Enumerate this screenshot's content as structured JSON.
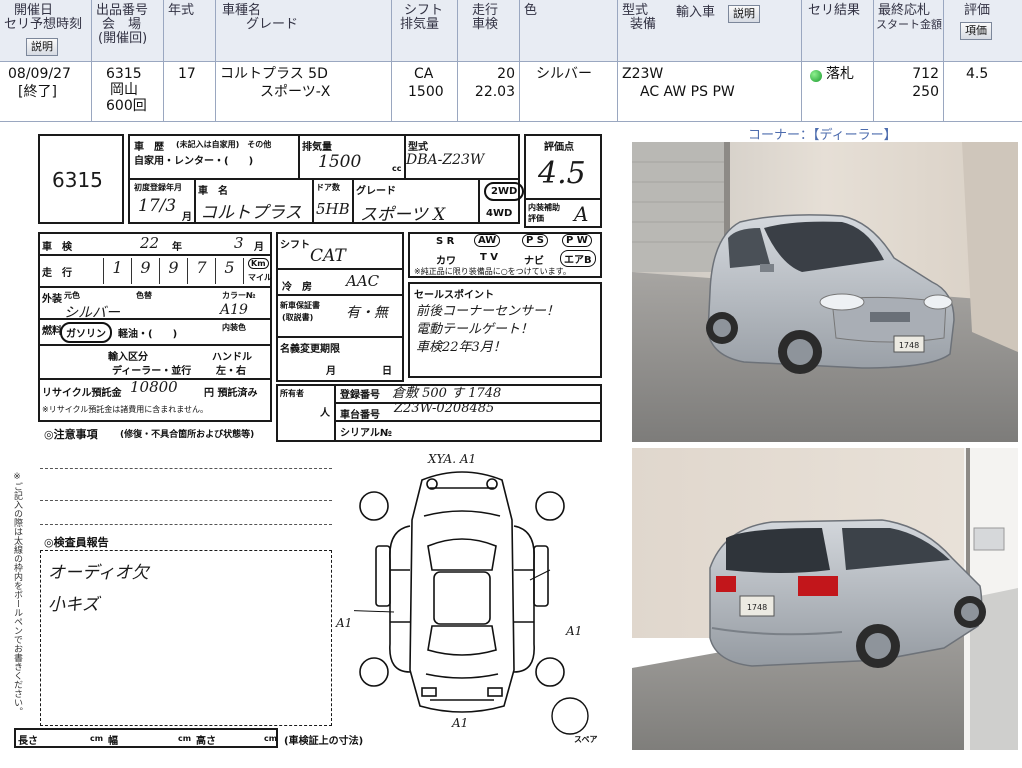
{
  "header": {
    "col_date": [
      "開催日",
      "セリ予想時刻"
    ],
    "col_lot": [
      "出品番号",
      "会　場",
      "(開催回)"
    ],
    "col_year": "年式",
    "col_model": [
      "車種名",
      "グレード"
    ],
    "col_shift": [
      "シフト",
      "排気量"
    ],
    "col_mileage": [
      "走行",
      "車検"
    ],
    "col_color": "色",
    "col_type": [
      "型式",
      "装備"
    ],
    "col_import": "輸入車",
    "col_result": "セリ結果",
    "col_price": [
      "最終応札",
      "スタート金額"
    ],
    "col_score": "評価",
    "explain_button": "説明",
    "explain_button2": "説明",
    "score_button": "項価"
  },
  "lot": {
    "date": "08/09/27",
    "status": "[終了]",
    "lot_number": "6315",
    "venue": "岡山",
    "session": "600回",
    "year": "17",
    "model": "コルトプラス 5D",
    "grade": "スポーツ-X",
    "shift": "CA",
    "displacement": "1500",
    "mileage": "20",
    "inspection": "22.03",
    "color": "シルバー",
    "type_code": "Z23W",
    "equipment": "AC AW PS PW",
    "result": "落札",
    "final_bid": "712",
    "start_price": "250",
    "score": "4.5",
    "result_color": "#22b14c"
  },
  "sheet": {
    "lot_no": "6315",
    "history_label": "車　歴",
    "history_options": "(未記入は自家用)　その他",
    "history_value": "自家用・レンター・(　　)",
    "displacement_label": "排気量",
    "displacement_hand": "1500",
    "displacement_unit": "cc",
    "type_label": "型式",
    "type_hand": "DBA-Z23W",
    "score_label": "評価点",
    "score_hand": "4.5",
    "first_reg_label": "初度登録年月",
    "first_reg_hand": "17/3",
    "first_reg_unit": "月",
    "name_label": "車　名",
    "name_hand": "コルトプラス",
    "doors_label": "ドア数",
    "doors_hand": "5HB",
    "grade_label": "グレード",
    "grade_hand": "スポーツ X",
    "drive_2wd": "2WD",
    "drive_4wd": "4WD",
    "interior_label": "内装補助評価",
    "interior_hand": "A",
    "inspection_label": "車　検",
    "inspection_year": "22",
    "inspection_year_unit": "年",
    "inspection_month": "3",
    "inspection_month_unit": "月",
    "mileage_label": "走　行",
    "mileage_digits": [
      "1",
      "9",
      "9",
      "7",
      "5"
    ],
    "mileage_unit_km": "Km",
    "mileage_unit_mile": "マイル",
    "shift_label": "シフト",
    "shift_hand": "CAT",
    "cooler_label": "冷　房",
    "cooler_hand": "AAC",
    "exterior_color_label": "外装",
    "orig_color_label": "元色",
    "color_change_label": "色替",
    "color_code_label": "カラー№",
    "exterior_color_hand": "シルバー",
    "color_code_hand": "A19",
    "fuel_label": "燃料",
    "fuel_hand": "ガソリン",
    "fuel_other": "軽油・(　　)",
    "interior_color_label": "内装色",
    "warranty_label": "新車保証書",
    "warranty_sub": "(取説書)",
    "warranty_hand": "有・無",
    "import_label": "輸入区分",
    "handle_label": "ハンドル",
    "import_hand": "ディーラー・並行",
    "handle_hand": "左・右",
    "recycle_label": "リサイクル預託金",
    "recycle_hand": "10800",
    "recycle_unit": "円 預託済み",
    "recycle_note": "※リサイクル預託金は諸費用に含まれません。",
    "name_change_label": "名義変更期限",
    "name_change_month": "月",
    "name_change_day": "日",
    "equip_sr": "S R",
    "equip_aw": "AW",
    "equip_ps": "P S",
    "equip_pw": "P W",
    "equip_kawa": "カワ",
    "equip_tv": "T V",
    "equip_navi": "ナビ",
    "equip_airbag": "エアB",
    "equip_note": "※純正品に限り装備品に○をつけています。",
    "sales_label": "セールスポイント",
    "sales_lines": [
      "前後コーナーセンサー！",
      "電動テールゲート！",
      "車検22年3月！"
    ],
    "owner_label": "所有者",
    "owner_sub": "人",
    "reg_no_label": "登録番号",
    "reg_no_hand": "倉敷 500 す 1748",
    "chassis_label": "車台番号",
    "chassis_hand": "Z23W-0208485",
    "serial_label": "シリアル№",
    "cautions_label": "◎注意事項",
    "cautions_sub": "(修復・不具合箇所および状態等)",
    "inspector_label": "◎検査員報告",
    "inspector_lines": [
      "オーディオ欠",
      "小キズ"
    ],
    "diagram_top_note": "XYA. A1",
    "diagram_left_note": "A1",
    "diagram_right_note": "A1",
    "diagram_bottom_note": "A1",
    "spare_label": "スペア",
    "length_label": "長さ",
    "width_label": "幅",
    "height_label": "高さ",
    "cm": "cm",
    "dims_note": "(車検証上の寸法)",
    "side_note": "※ご記入の際は太線の枠内をボールペンでお書きください。"
  },
  "photos": {
    "corner_label": "コーナー：【ディーラー】",
    "front_plate": "1748",
    "rear_plate": "1748",
    "car_color": "#b9bec5",
    "wall_color": "#ddd6cd",
    "floor_color": "#8f8e8c"
  }
}
